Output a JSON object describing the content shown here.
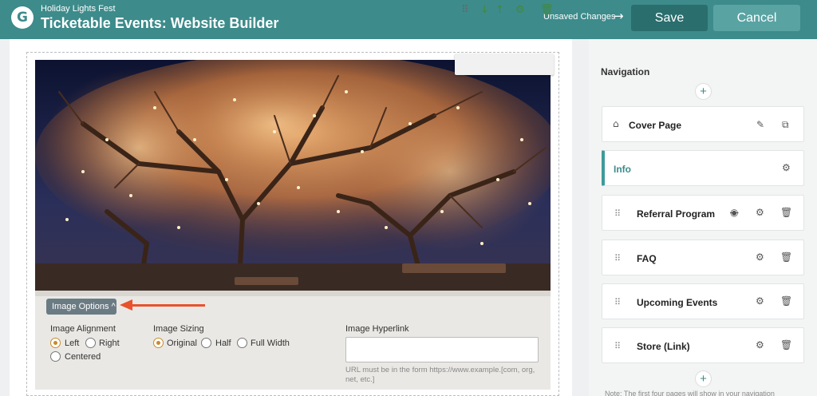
{
  "header": {
    "org": "Holiday Lights Fest",
    "title": "Ticketable Events: Website Builder",
    "unsaved": "Unsaved Changes",
    "save_label": "Save",
    "cancel_label": "Cancel"
  },
  "image_options": {
    "toggle_label": "Image Options ^",
    "alignment_label": "Image Alignment",
    "alignment_options": [
      "Left",
      "Right",
      "Centered"
    ],
    "alignment_selected": "Left",
    "sizing_label": "Image Sizing",
    "sizing_options": [
      "Original",
      "Half",
      "Full Width"
    ],
    "sizing_selected": "Original",
    "hyperlink_label": "Image Hyperlink",
    "hyperlink_value": "",
    "hyperlink_hint": "URL must be in the form https://www.example.[com, org, net, etc.]"
  },
  "navigation": {
    "title": "Navigation",
    "add_symbol": "+",
    "pages": [
      {
        "label": "Cover Page"
      },
      {
        "label": "Info"
      },
      {
        "label": "Referral Program"
      },
      {
        "label": "FAQ"
      },
      {
        "label": "Upcoming Events"
      },
      {
        "label": "Store (Link)"
      }
    ],
    "footer_note": "Note: The first four pages will show in your navigation"
  },
  "colors": {
    "brand": "#3d8b8b",
    "save_bg": "#2a6e6e",
    "cancel_bg": "#5aa3a3",
    "arrow": "#e8522d",
    "radio_selected": "#c98a2e"
  },
  "icons": [
    "grip-icon",
    "arrow-down-icon",
    "arrow-up-icon",
    "gear-icon",
    "trash-icon",
    "home-icon",
    "edit-icon",
    "external-link-icon",
    "eye-off-icon",
    "drag-handle-icon",
    "plus-icon",
    "arrow-right-icon"
  ]
}
